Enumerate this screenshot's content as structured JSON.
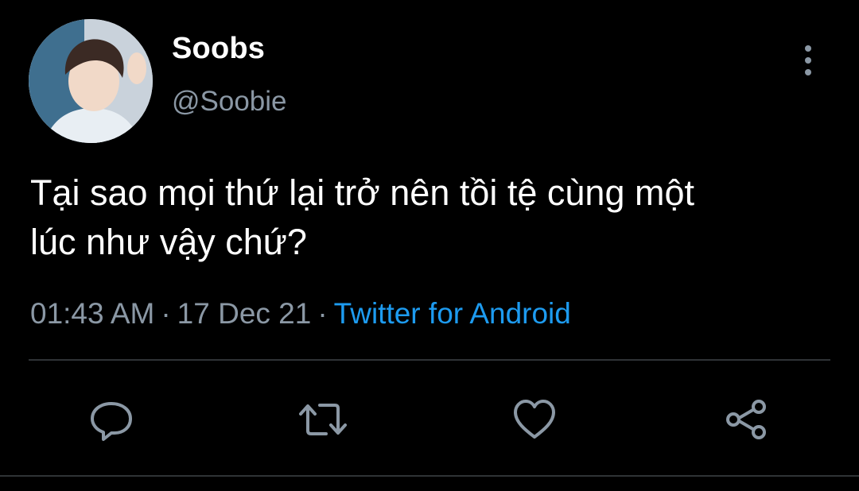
{
  "author": {
    "display_name": "Soobs",
    "handle": "@Soobie"
  },
  "tweet": {
    "text_lines": [
      "Tại sao mọi thứ lại trở nên tồi tệ cùng một",
      "lúc như vậy chứ?"
    ]
  },
  "meta": {
    "time": "01:43 AM",
    "separator": "·",
    "date": "17 Dec 21",
    "source": "Twitter for Android"
  },
  "actions": {
    "reply_icon": "reply-icon",
    "retweet_icon": "retweet-icon",
    "like_icon": "heart-icon",
    "share_icon": "share-icon"
  },
  "colors": {
    "background": "#000000",
    "secondary_text": "#8b98a5",
    "link": "#1d9bf0",
    "divider": "#2f3336"
  }
}
